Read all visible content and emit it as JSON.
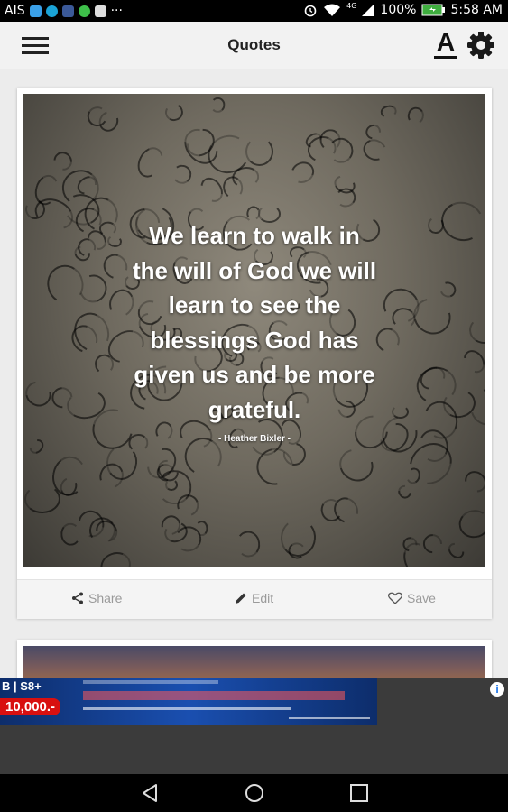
{
  "status_bar": {
    "carrier": "AIS",
    "overflow": "···",
    "network": "4G",
    "battery_percent": "100%",
    "time": "5:58 AM"
  },
  "app_bar": {
    "title": "Quotes",
    "font_button_glyph": "A"
  },
  "quote_card": {
    "lines": [
      "We learn to walk in",
      "the will of God we will",
      "learn to see the",
      "blessings God has",
      "given us and be more",
      "grateful."
    ],
    "author": "- Heather Bixler -",
    "actions": {
      "share": "Share",
      "edit": "Edit",
      "save": "Save"
    }
  },
  "ad_banner": {
    "brand": "B | S8+",
    "price": "10,000.-",
    "info_glyph": "i"
  },
  "colors": {
    "app_bar_bg": "#f2f2f2",
    "action_text": "#9a9a9a",
    "ad_price_bg": "#d81010",
    "ad_bg": "#1a4fb0"
  },
  "icons": [
    "hamburger-icon",
    "font-size-icon",
    "gear-icon",
    "share-icon",
    "pencil-icon",
    "heart-icon",
    "back-icon",
    "home-icon",
    "recents-icon",
    "wifi-icon",
    "battery-icon",
    "alarm-icon",
    "signal-icon"
  ]
}
